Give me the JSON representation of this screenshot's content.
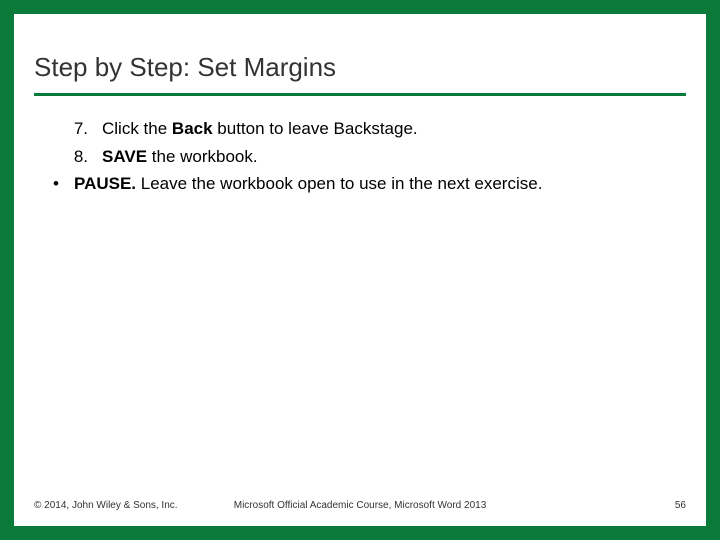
{
  "title": "Step by Step: Set Margins",
  "steps": {
    "item7_num": "7.",
    "item7_pre": "Click the ",
    "item7_bold": "Back",
    "item7_post": " button to leave Backstage.",
    "item8_num": "8.",
    "item8_bold": " SAVE",
    "item8_post": " the workbook.",
    "bullet_marker": "•",
    "pause_bold": "PAUSE.",
    "pause_post": " Leave the workbook open to use in the next exercise."
  },
  "footer": {
    "copyright": "© 2014, John Wiley & Sons, Inc.",
    "course": "Microsoft Official Academic Course, Microsoft Word 2013",
    "page": "56"
  }
}
